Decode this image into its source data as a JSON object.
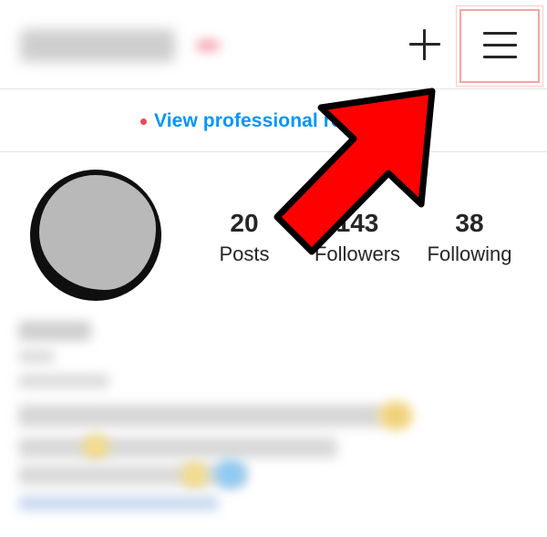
{
  "header": {
    "add_icon": "plus-icon",
    "menu_icon": "hamburger-menu-icon",
    "highlight_color": "#f2a4a4"
  },
  "professional": {
    "label": "View professional re",
    "dot_color": "#ed4956",
    "link_color": "#0095f6"
  },
  "stats": [
    {
      "value": "20",
      "label": "Posts"
    },
    {
      "value": "143",
      "label": "Followers"
    },
    {
      "value": "38",
      "label": "Following"
    }
  ],
  "annotation": {
    "arrow_color": "#ff0000",
    "arrow_outline": "#000000"
  }
}
